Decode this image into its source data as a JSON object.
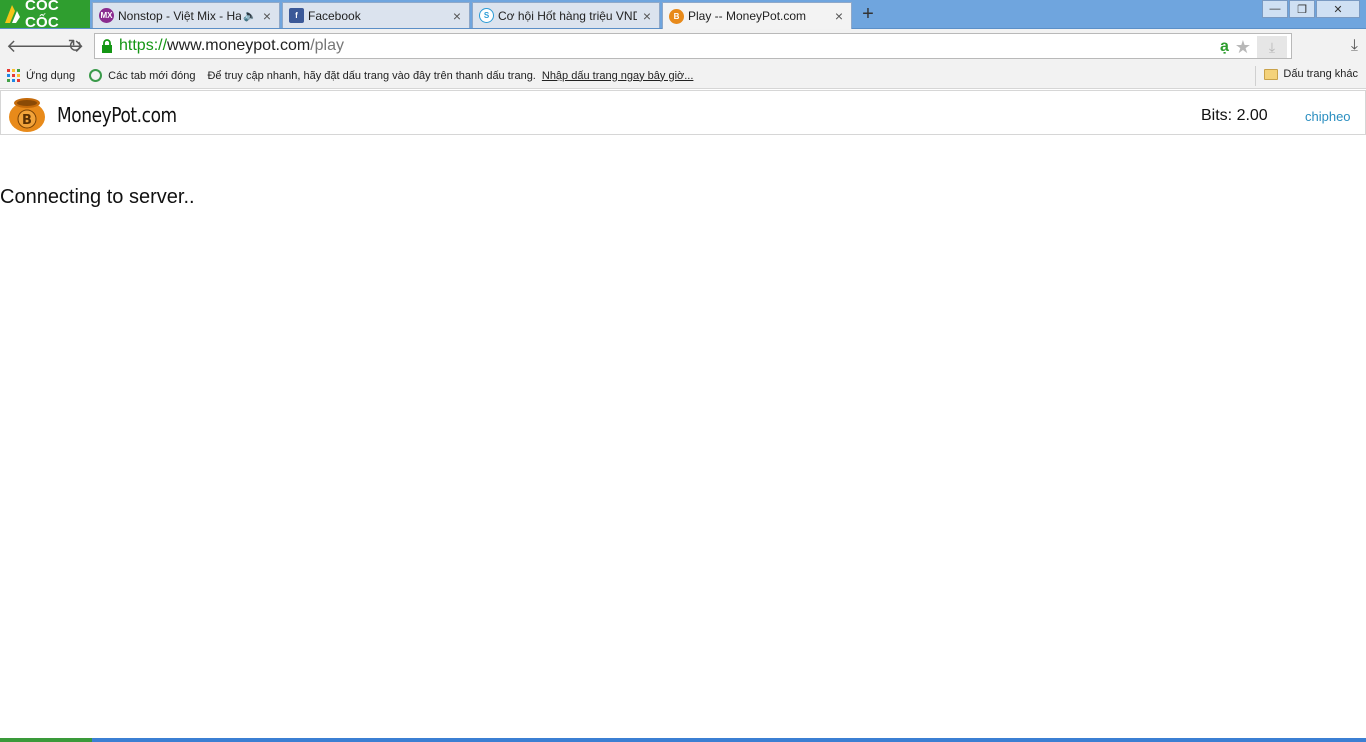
{
  "browser": {
    "brand_name": "CỐC CỐC",
    "tabs": [
      {
        "title": "Nonstop - Việt Mix - Hay n",
        "favicon": "mx-icon",
        "favicon_text": "MX",
        "favicon_color": "#8a2b8f",
        "audio": true
      },
      {
        "title": "Facebook",
        "favicon": "facebook-icon",
        "favicon_text": "f",
        "favicon_color": "#3b5998",
        "audio": false
      },
      {
        "title": "Cơ hội Hốt hàng triệu VND c",
        "favicon": "coin-icon",
        "favicon_text": "S",
        "favicon_color": "#2a9bd6",
        "audio": false
      },
      {
        "title": "Play -- MoneyPot.com",
        "favicon": "moneypot-icon",
        "favicon_text": "B",
        "favicon_color": "#e88a1a",
        "audio": false,
        "active": true
      }
    ],
    "new_tab_symbol": "+",
    "window_controls": {
      "minimize": "—",
      "restore": "❐",
      "close": "✕"
    }
  },
  "address_bar": {
    "url_scheme": "https://",
    "url_host": "www.moneypot.com",
    "url_path": "/play",
    "extension_letter": "ạ",
    "star_symbol": "★",
    "download_symbol": "⤓"
  },
  "bookmarks_bar": {
    "apps_label": "Ứng dụng",
    "recent_tabs_label": "Các tab mới đóng",
    "hint_text": "Để truy cập nhanh, hãy đặt dấu trang vào đây trên thanh dấu trang.",
    "import_link": "Nhập dấu trang ngay bây giờ...",
    "other_bookmarks": "Dấu trang khác",
    "apps_colors": [
      "#e53935",
      "#fbc02d",
      "#43a047",
      "#1e88e5",
      "#e53935",
      "#fbc02d",
      "#43a047",
      "#1e88e5",
      "#e53935"
    ]
  },
  "site": {
    "logo_text": "MoneyPot.com",
    "bits_label": "Bits: 2.00",
    "username": "chipheo",
    "status_message": "Connecting to server.."
  },
  "colors": {
    "brand_green": "#2f9e2f",
    "tabstrip_blue": "#6fa5de",
    "link_blue": "#2a8ec0",
    "pot_orange": "#e88a1a"
  }
}
